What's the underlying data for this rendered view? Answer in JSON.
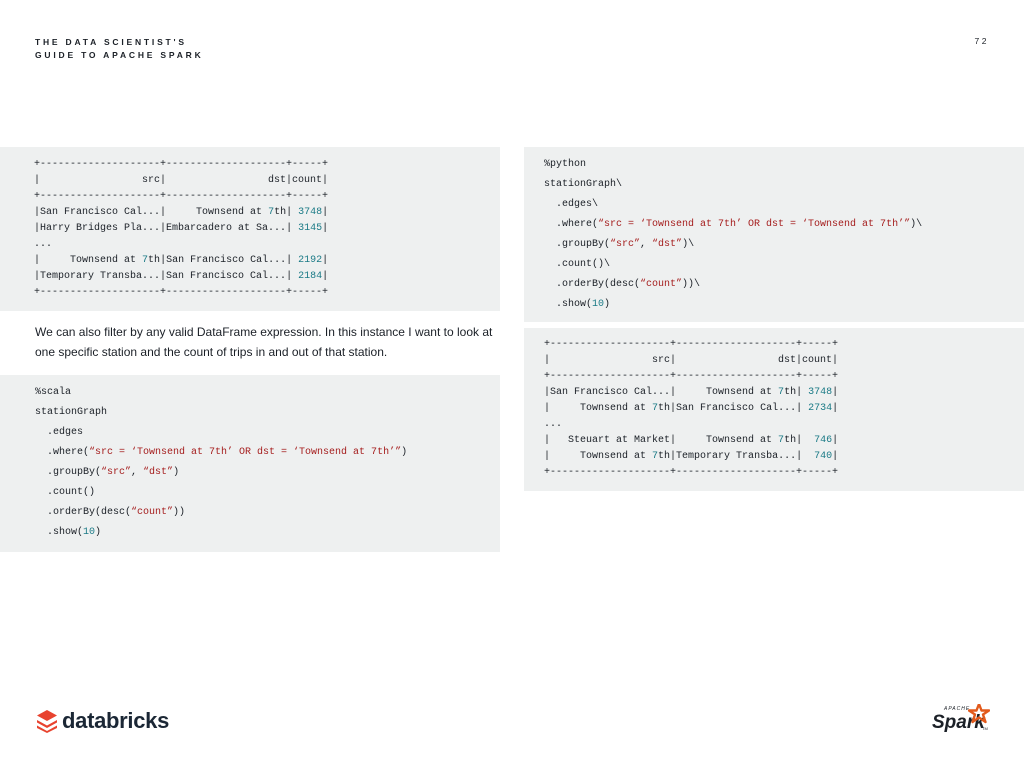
{
  "header": {
    "title_line1": "THE DATA SCIENTIST'S",
    "title_line2": "GUIDE TO APACHE SPARK",
    "page_number": "72"
  },
  "body": {
    "paragraph": "We can also filter by any valid DataFrame expression. In this instance I want to look at one specific station and the count of trips in and out of that station."
  },
  "output_table_1": {
    "border": "+--------------------+--------------------+-----+",
    "header_row": "|                 src|                 dst|count|",
    "rows": [
      {
        "src": "|San Francisco Cal...",
        "dst_pre": "|     Townsend at ",
        "dst_num": "7",
        "dst_post": "th",
        "sep": "| ",
        "count": "3748",
        "end": "|"
      },
      {
        "src": "|Harry Bridges Pla...",
        "dst_pre": "|Embarcadero at Sa...",
        "dst_num": "",
        "dst_post": "",
        "sep": "| ",
        "count": "3145",
        "end": "|"
      },
      {
        "ellipsis": "..."
      },
      {
        "src_pre": "|     Townsend at ",
        "src_num": "7",
        "src_post": "th",
        "dst_pre": "|San Francisco Cal...",
        "sep": "| ",
        "count": "2192",
        "end": "|"
      },
      {
        "src": "|Temporary Transba...",
        "dst_pre": "|San Francisco Cal...",
        "sep": "| ",
        "count": "2184",
        "end": "|"
      }
    ]
  },
  "scala_code": {
    "magic": "%scala",
    "line1": "stationGraph",
    "line2": "  .edges",
    "where_pre": "  .where(",
    "where_str": "“src = ‘Townsend at 7th’ OR dst = ‘Townsend at 7th’”",
    "where_post": ")",
    "groupby_pre": "  .groupBy(",
    "groupby_s1": "“src”",
    "groupby_mid": ", ",
    "groupby_s2": "“dst”",
    "groupby_post": ")",
    "count": "  .count()",
    "orderby_pre": "  .orderBy(desc(",
    "orderby_str": "“count”",
    "orderby_post": "))",
    "show_pre": "  .show(",
    "show_num": "10",
    "show_post": ")"
  },
  "python_code": {
    "magic": "%python",
    "line1": "stationGraph\\",
    "line2": "  .edges\\",
    "where_pre": "  .where(",
    "where_str": "“src = ‘Townsend at 7th’ OR dst = ‘Townsend at 7th’”",
    "where_post": ")\\",
    "groupby_pre": "  .groupBy(",
    "groupby_s1": "“src”",
    "groupby_mid": ", ",
    "groupby_s2": "“dst”",
    "groupby_post": ")\\",
    "count": "  .count()\\",
    "orderby_pre": "  .orderBy(desc(",
    "orderby_str": "“count”",
    "orderby_post": "))\\",
    "show_pre": "  .show(",
    "show_num": "10",
    "show_post": ")"
  },
  "output_table_2": {
    "border": "+--------------------+--------------------+-----+",
    "header_row": "|                 src|                 dst|count|",
    "r1_a": "|San Francisco Cal...|     Townsend at ",
    "r1_n": "7",
    "r1_b": "th| ",
    "r1_c": "3748",
    "r1_e": "|",
    "r2_a": "|     Townsend at ",
    "r2_n": "7",
    "r2_b": "th|San Francisco Cal...| ",
    "r2_c": "2734",
    "r2_e": "|",
    "ellipsis": "...",
    "r3_a": "|   Steuart at Market|     Townsend at ",
    "r3_n": "7",
    "r3_b": "th|  ",
    "r3_c": "746",
    "r3_e": "|",
    "r4_a": "|     Townsend at ",
    "r4_n": "7",
    "r4_b": "th|Temporary Transba...|  ",
    "r4_c": "740",
    "r4_e": "|"
  },
  "footer": {
    "databricks_logo_text": "databricks",
    "spark_logo_text": "Spark",
    "spark_logo_apache": "APACHE",
    "spark_logo_tm": "TM"
  },
  "colors": {
    "panel_bg": "#eef0f0",
    "string": "#a51d1d",
    "number": "#1a7a86",
    "databricks_red": "#e8432f",
    "spark_orange": "#e25a1c"
  }
}
